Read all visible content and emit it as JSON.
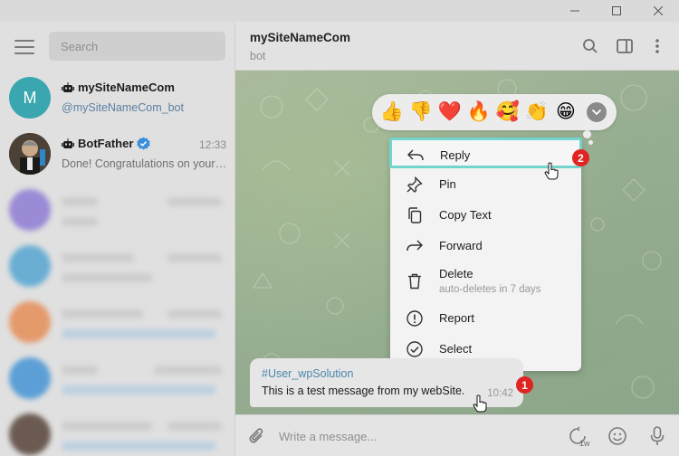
{
  "sidebar": {
    "search_placeholder": "Search",
    "chats": [
      {
        "initial": "M",
        "name": "mySiteNameCom",
        "subtitle": "@mySiteNameCom_bot",
        "time": "",
        "avatar_color": "#3aa6b0"
      },
      {
        "initial": "",
        "name": "BotFather",
        "subtitle": "Done! Congratulations on your new bot.",
        "time": "12:33",
        "avatar_color": "#5a4a3a"
      }
    ]
  },
  "header": {
    "title": "mySiteNameCom",
    "subtitle": "bot"
  },
  "reactions": [
    "👍",
    "👎",
    "❤️",
    "🔥",
    "🥰",
    "👏",
    "😁"
  ],
  "context_menu": {
    "items": [
      {
        "label": "Reply",
        "icon": "reply-icon"
      },
      {
        "label": "Pin",
        "icon": "pin-icon"
      },
      {
        "label": "Copy Text",
        "icon": "copy-icon"
      },
      {
        "label": "Forward",
        "icon": "forward-icon"
      },
      {
        "label": "Delete",
        "icon": "trash-icon",
        "sub": "auto-deletes in 7 days"
      },
      {
        "label": "Report",
        "icon": "report-icon"
      },
      {
        "label": "Select",
        "icon": "select-icon"
      }
    ]
  },
  "message": {
    "sender": "#User_wpSolution",
    "text": "This is a test message from my webSite.",
    "time": "10:42"
  },
  "badges": {
    "one": "1",
    "two": "2"
  },
  "composer": {
    "placeholder": "Write a message...",
    "slowmode": "1w"
  },
  "colors": {
    "accent": "#73d4ce",
    "badge": "#e02424",
    "link": "#4a86ad"
  }
}
